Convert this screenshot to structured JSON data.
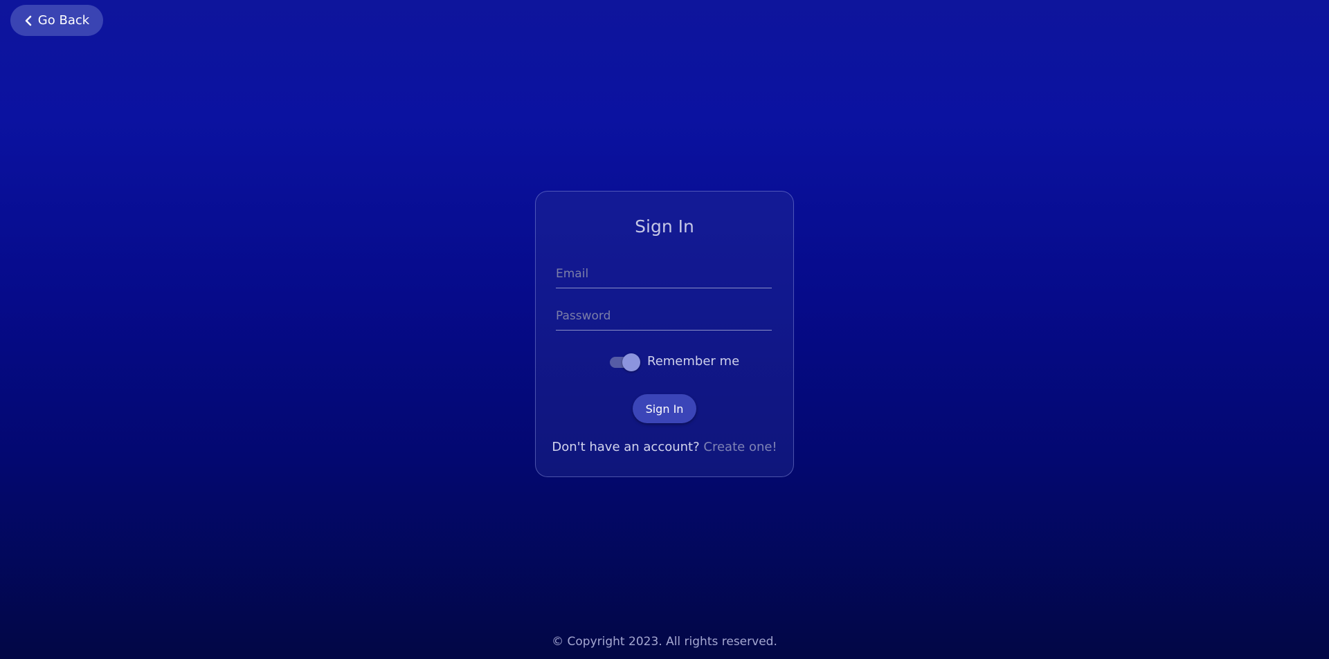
{
  "header": {
    "go_back_label": "Go Back",
    "go_back_icon": "chevron-left-icon"
  },
  "signin_card": {
    "title": "Sign In",
    "email": {
      "value": "",
      "placeholder": "Email"
    },
    "password": {
      "value": "",
      "placeholder": "Password"
    },
    "remember": {
      "label": "Remember me",
      "checked": true
    },
    "submit_label": "Sign In",
    "signup_prompt": "Don't have an account?",
    "signup_link": "Create one!"
  },
  "footer": {
    "copyright": "© Copyright 2023. All rights reserved."
  },
  "colors": {
    "accent": "#3b45b8",
    "background_top": "#0e159c",
    "background_bottom": "#020745"
  }
}
